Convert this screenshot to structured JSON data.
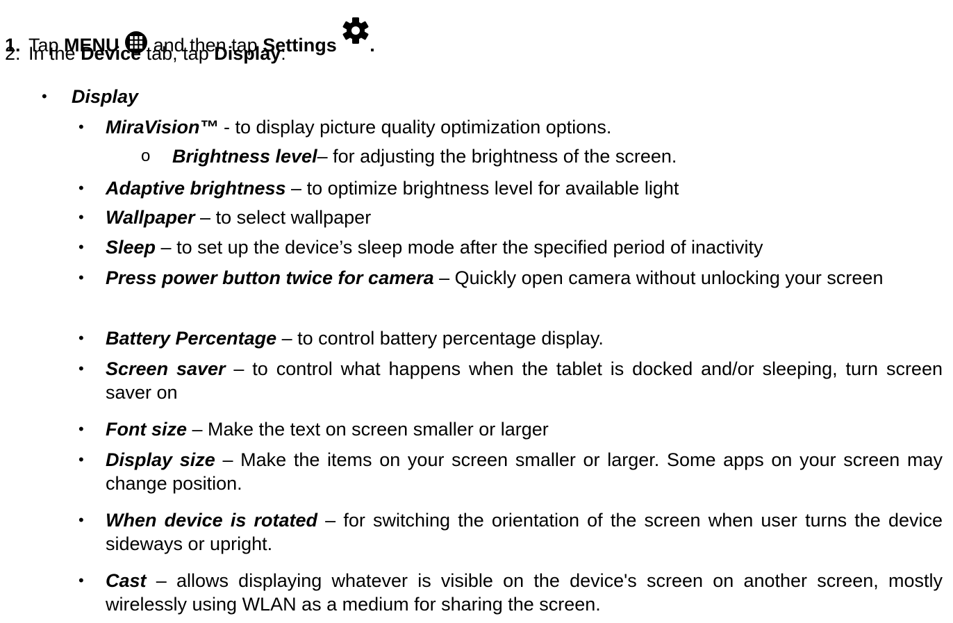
{
  "steps": [
    {
      "number": "1.",
      "parts": [
        "Tap ",
        "MENU",
        " and then tap ",
        "Settings",
        "."
      ],
      "icons": [
        "menu-grid-icon",
        "settings-gear-icon"
      ]
    },
    {
      "number": "2.",
      "parts": [
        "In the ",
        "Device",
        " tab, tap ",
        "Display",
        ":"
      ]
    }
  ],
  "section": {
    "title": "Display"
  },
  "items": [
    {
      "term": "MiraVision™",
      "desc": " - to display picture quality optimization options."
    },
    {
      "term": "Brightness level",
      "desc": "– for adjusting the brightness of the screen."
    },
    {
      "term": "Adaptive brightness",
      "desc": " – to optimize brightness level for available light"
    },
    {
      "term": "Wallpaper",
      "desc": " – to select wallpaper"
    },
    {
      "term": "Sleep",
      "desc": " – to set up the device’s sleep mode after the specified period of inactivity"
    },
    {
      "term": "Press power button twice for camera",
      "desc": " – Quickly open camera without unlocking your screen"
    },
    {
      "term": "Battery Percentage",
      "desc": " – to control battery percentage display."
    },
    {
      "term": "Screen saver",
      "desc": " – to control what happens when the tablet is docked and/or sleeping, turn screen saver on"
    },
    {
      "term": "Font size",
      "desc": " – Make the text on screen smaller or larger"
    },
    {
      "term": "Display size",
      "desc": " – Make the items on your screen smaller or larger. Some apps on your screen may change position."
    },
    {
      "term": "When device is rotated",
      "desc": " – for switching the orientation of the screen when user turns the device sideways or upright."
    },
    {
      "term": "Cast",
      "desc": " – allows displaying whatever is visible on the device's screen on another screen, mostly wirelessly using WLAN as a medium for sharing the screen."
    }
  ],
  "symbols": {
    "bullet": "•",
    "sub_bullet": "o"
  }
}
